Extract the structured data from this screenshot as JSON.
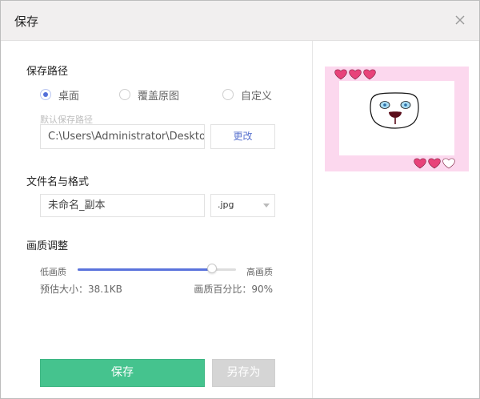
{
  "dialog": {
    "title": "保存",
    "close_icon": "close-icon"
  },
  "save_path": {
    "section_title": "保存路径",
    "options": [
      {
        "label": "桌面",
        "checked": true
      },
      {
        "label": "覆盖原图",
        "checked": false
      },
      {
        "label": "自定义",
        "checked": false
      }
    ],
    "hint": "默认保存路径",
    "path_value": "C:\\Users\\Administrator\\Desktop",
    "change_label": "更改"
  },
  "filename": {
    "section_title": "文件名与格式",
    "name_value": "未命名_副本",
    "format_value": ".jpg"
  },
  "quality": {
    "section_title": "画质调整",
    "low_label": "低画质",
    "high_label": "高画质",
    "level": 0.85,
    "estimate_text": "预估大小：38.1KB",
    "percent_text": "画质百分比：90%",
    "accent_color": "#5a73dc"
  },
  "actions": {
    "save_label": "保存",
    "save_as_label": "另存为",
    "save_color": "#45c38e"
  },
  "preview": {
    "background_color": "#fcd8ee",
    "heart_color": "#e8437a"
  }
}
